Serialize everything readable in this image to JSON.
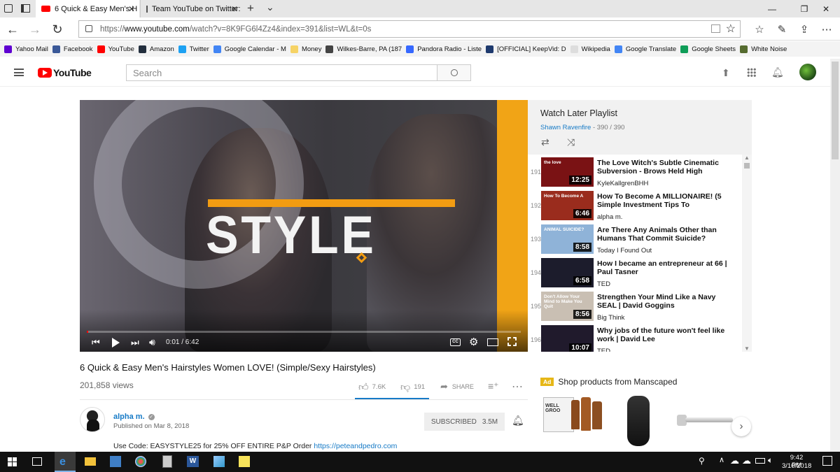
{
  "browser": {
    "tabs": [
      {
        "title": "6 Quick & Easy Men's H",
        "active": true
      },
      {
        "title": "Team YouTube on Twitter: \"",
        "active": false
      }
    ],
    "new_tab": "+",
    "tab_overflow": "⌄",
    "window_controls": {
      "minimize": "—",
      "restore": "❐",
      "close": "✕"
    },
    "url_scheme": "https://",
    "url_host": "www.youtube.com",
    "url_path": "/watch?v=8K9FG6l4Zz4&index=391&list=WL&t=0s",
    "favorites": [
      {
        "label": "Yahoo Mail",
        "color": "#5f01d1"
      },
      {
        "label": "Facebook",
        "color": "#3b5998"
      },
      {
        "label": "YouTube",
        "color": "#ff0000"
      },
      {
        "label": "Amazon",
        "color": "#232f3e"
      },
      {
        "label": "Twitter",
        "color": "#1da1f2"
      },
      {
        "label": "Google Calendar - M",
        "color": "#4285f4"
      },
      {
        "label": "Money",
        "color": "#f6d365"
      },
      {
        "label": "Wilkes-Barre, PA (187",
        "color": "#444444"
      },
      {
        "label": "Pandora Radio - Liste",
        "color": "#3668ff"
      },
      {
        "label": "[OFFICIAL] KeepVid: D",
        "color": "#1e3a6e"
      },
      {
        "label": "Wikipedia",
        "color": "#dddddd"
      },
      {
        "label": "Google Translate",
        "color": "#4285f4"
      },
      {
        "label": "Google Sheets",
        "color": "#0f9d58"
      },
      {
        "label": "White Noise",
        "color": "#556b2f"
      }
    ]
  },
  "youtube": {
    "logo_text": "YouTube",
    "search_placeholder": "Search",
    "player": {
      "overlay_text": "STYLE",
      "time": "0:01 / 6:42",
      "progress_fraction": 0.003
    },
    "playlist": {
      "title": "Watch Later Playlist",
      "owner": "Shawn Ravenfire",
      "position": "- 390 / 390",
      "items": [
        {
          "index": "191",
          "title": "The Love Witch's Subtle Cinematic Subversion - Brows Held High",
          "channel": "KyleKallgrenBHH",
          "duration": "12:25",
          "thumb": "#7a1214",
          "thumb_text": "the love"
        },
        {
          "index": "192",
          "title": "How To Become A MILLIONAIRE! (5 Simple Investment Tips To",
          "channel": "alpha m.",
          "duration": "6:46",
          "thumb": "#9a2c1d",
          "thumb_text": "How To Become A"
        },
        {
          "index": "193",
          "title": "Are There Any Animals Other than Humans That Commit Suicide?",
          "channel": "Today I Found Out",
          "duration": "8:58",
          "thumb": "#8fb3d8",
          "thumb_text": "ANIMAL SUICIDE?"
        },
        {
          "index": "194",
          "title": "How I became an entrepreneur at 66 | Paul Tasner",
          "channel": "TED",
          "duration": "6:58",
          "thumb": "#1c1c2c",
          "thumb_text": ""
        },
        {
          "index": "195",
          "title": "Strengthen Your Mind Like a Navy SEAL | David Goggins",
          "channel": "Big Think",
          "duration": "8:56",
          "thumb": "#c9bfb3",
          "thumb_text": "Don't Allow Your Mind to Make You Quit"
        },
        {
          "index": "196",
          "title": "Why jobs of the future won't feel like work | David Lee",
          "channel": "TED",
          "duration": "10:07",
          "thumb": "#201a2c",
          "thumb_text": ""
        }
      ]
    },
    "video": {
      "title": "6 Quick & Easy Men's Hairstyles Women LOVE! (Simple/Sexy Hairstyles)",
      "views": "201,858 views",
      "likes": "7.6K",
      "dislikes": "191",
      "share": "SHARE",
      "channel": "alpha m.",
      "published": "Published on Mar 8, 2018",
      "subscribed": "SUBSCRIBED",
      "subscribers": "3.5M",
      "description_text": "Use Code: EASYSTYLE25 for 25% OFF ENTIRE P&P Order ",
      "description_link": "https://peteandpedro.com"
    },
    "ad": {
      "badge": "Ad",
      "title": "Shop products from Manscaped",
      "product1_text": "WELL GROO"
    }
  },
  "taskbar": {
    "time": "9:42 PM",
    "date": "3/10/2018"
  }
}
